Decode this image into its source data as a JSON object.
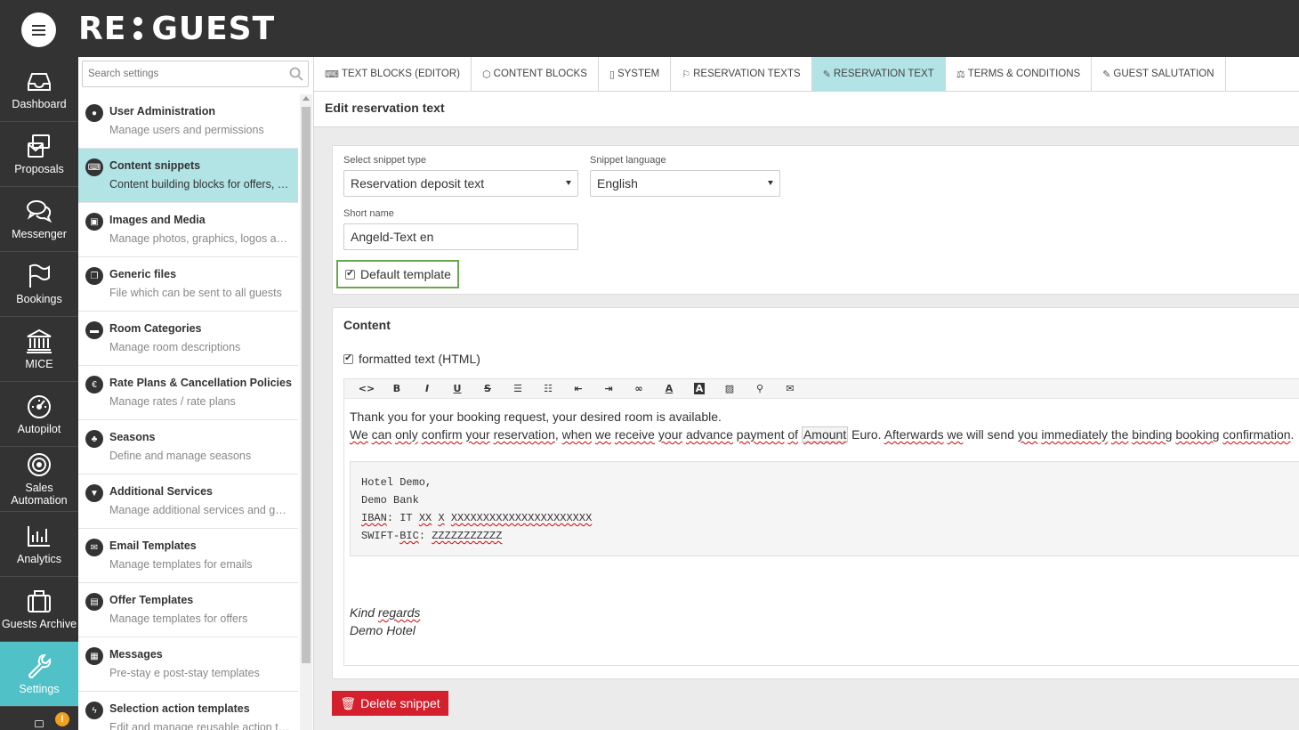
{
  "app": {
    "brand_left": "RE",
    "brand_right": "GUEST"
  },
  "nav": [
    {
      "label": "Dashboard",
      "icon": "inbox-icon"
    },
    {
      "label": "Proposals",
      "icon": "proposals-icon"
    },
    {
      "label": "Messenger",
      "icon": "chat-icon"
    },
    {
      "label": "Bookings",
      "icon": "flag-icon"
    },
    {
      "label": "MICE",
      "icon": "building-icon"
    },
    {
      "label": "Autopilot",
      "icon": "speedometer-icon"
    },
    {
      "label": "Sales Automation",
      "icon": "target-icon"
    },
    {
      "label": "Analytics",
      "icon": "bar-chart-icon"
    },
    {
      "label": "Guests Archive",
      "icon": "suitcase-icon"
    },
    {
      "label": "Settings",
      "icon": "wrench-icon",
      "active": true
    }
  ],
  "nav_badge": "!",
  "search": {
    "placeholder": "Search settings"
  },
  "settings": [
    {
      "title": "User Administration",
      "desc": "Manage users and permissions",
      "icon": "user-icon"
    },
    {
      "title": "Content snippets",
      "desc": "Content building blocks for offers, pl...",
      "icon": "keyboard-icon",
      "active": true
    },
    {
      "title": "Images and Media",
      "desc": "Manage photos, graphics, logos and ...",
      "icon": "image-icon"
    },
    {
      "title": "Generic files",
      "desc": "File which can be sent to all guests",
      "icon": "files-icon"
    },
    {
      "title": "Room Categories",
      "desc": "Manage room descriptions",
      "icon": "bed-icon"
    },
    {
      "title": "Rate Plans & Cancellation Policies",
      "desc": "Manage rates / rate plans",
      "icon": "money-icon"
    },
    {
      "title": "Seasons",
      "desc": "Define and manage seasons",
      "icon": "leaf-icon"
    },
    {
      "title": "Additional Services",
      "desc": "Manage additional services and gen...",
      "icon": "filter-icon"
    },
    {
      "title": "Email Templates",
      "desc": "Manage templates for emails",
      "icon": "envelope-icon"
    },
    {
      "title": "Offer Templates",
      "desc": "Manage templates for offers",
      "icon": "document-icon"
    },
    {
      "title": "Messages",
      "desc": "Pre-stay e post-stay templates",
      "icon": "message-doc-icon"
    },
    {
      "title": "Selection action templates",
      "desc": "Edit and manage reusable action te...",
      "icon": "bolt-icon"
    }
  ],
  "tabs": [
    {
      "label": "TEXT BLOCKS (EDITOR)",
      "icon": "keyboard-icon"
    },
    {
      "label": "CONTENT BLOCKS",
      "icon": "cube-icon"
    },
    {
      "label": "SYSTEM",
      "icon": "file-icon"
    },
    {
      "label": "RESERVATION TEXTS",
      "icon": "flag-icon"
    },
    {
      "label": "RESERVATION TEXT",
      "icon": "pencil-icon",
      "active": true
    },
    {
      "label": "TERMS & CONDITIONS",
      "icon": "scale-icon"
    },
    {
      "label": "GUEST SALUTATION",
      "icon": "pencil-icon"
    }
  ],
  "page_title": "Edit reservation text",
  "form": {
    "snippet_type_label": "Select snippet type",
    "snippet_type_value": "Reservation deposit text",
    "language_label": "Snippet language",
    "language_value": "English",
    "short_name_label": "Short name",
    "short_name_value": "Angeld-Text en",
    "default_template_label": "Default template",
    "default_template_checked": true
  },
  "content": {
    "heading": "Content",
    "formatted_label": "formatted text (HTML)",
    "formatted_checked": true,
    "toolbar": [
      "<>",
      "B",
      "I",
      "U",
      "S",
      "bulleted-list",
      "numbered-list",
      "outdent",
      "indent",
      "link",
      "A",
      "A",
      "image",
      "attachment",
      "email"
    ],
    "line1": "Thank you for your booking request, your desired room is available.",
    "line2_parts": [
      "We",
      " ",
      "can",
      " ",
      "only",
      " ",
      "confirm",
      " ",
      "your",
      " ",
      "reservation",
      ", ",
      "when",
      " ",
      "we",
      " ",
      "receive",
      " ",
      "your",
      " ",
      "advance",
      " ",
      "payment",
      " ",
      "of",
      " ",
      "Amount",
      " Euro. ",
      "Afterwards",
      " ",
      "we",
      " will send ",
      "you",
      " ",
      "immediately",
      " ",
      "the",
      " ",
      "binding",
      " ",
      "booking",
      " ",
      "confirmation",
      "."
    ],
    "code_lines": [
      "Hotel Demo,",
      "Demo Bank",
      "IBAN: IT XX X XXXXXXXXXXXXXXXXXXXXXX",
      "SWIFT-BIC: ZZZZZZZZZZZ"
    ],
    "closing1": "Kind regards",
    "closing2": "Demo Hotel"
  },
  "delete_label": "Delete snippet",
  "colors": {
    "accent": "#4fc1c7",
    "active_light": "#b2e3e5",
    "danger": "#d41f2d",
    "dark": "#333333",
    "highlight_border": "#6aa84f"
  }
}
